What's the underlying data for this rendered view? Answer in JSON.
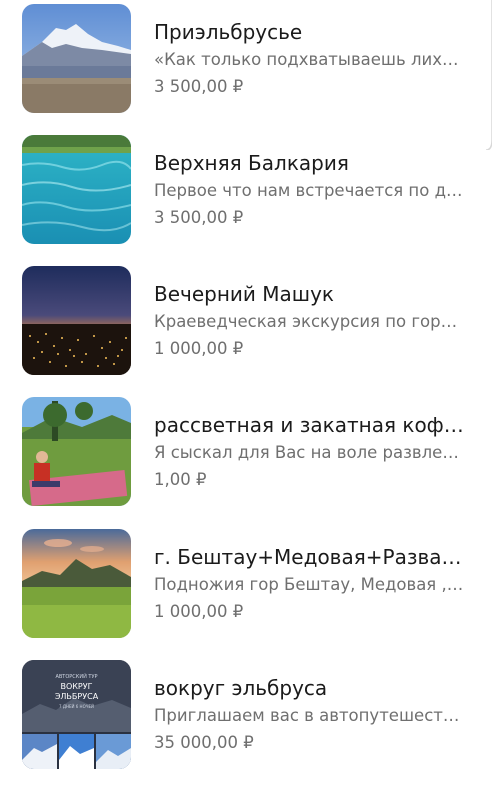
{
  "items": [
    {
      "title": "Приэльбрусье",
      "description": "«Как только подхватываешь лихорадку гор…",
      "price": "3 500,00 ₽",
      "image": "mountain-elbrus-image"
    },
    {
      "title": "Верхняя Балкария",
      "description": "Первое что нам встречается по дороге…",
      "price": "3 500,00 ₽",
      "image": "turquoise-lake-image"
    },
    {
      "title": "Вечерний Машук",
      "description": "Краеведческая экскурсия по городу…",
      "price": "1 000,00 ₽",
      "image": "night-city-image"
    },
    {
      "title": "рассветная и закатная кофе-медитация",
      "description": "Я сыскал для Вас на воле развлечение…",
      "price": "1,00 ₽",
      "image": "meditation-meadow-image"
    },
    {
      "title": "г. Бештау+Медовая+Развалка",
      "description": "Подножия гор Бештау, Медовая , Развалка…",
      "price": "1 000,00 ₽",
      "image": "beshtau-mountain-image"
    },
    {
      "title": "вокруг эльбруса",
      "description": "Приглашаем вас в автопутешествие…",
      "price": "35 000,00 ₽",
      "image": "around-elbrus-poster-image",
      "poster_small": "АВТОРСКИЙ ТУР",
      "poster_title_line1": "ВОКРУГ",
      "poster_title_line2": "ЭЛЬБРУСА",
      "poster_sub": "7 ДНЕЙ 6 НОЧЕЙ"
    }
  ]
}
